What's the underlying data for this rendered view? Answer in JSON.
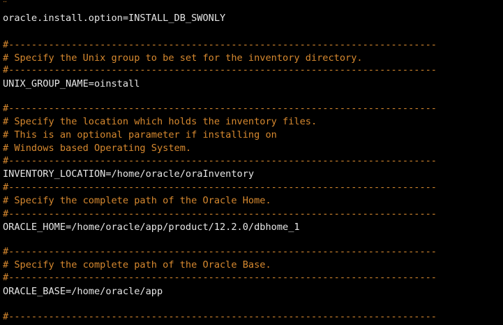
{
  "lines": [
    {
      "text": "#---------------------------------------------------------------------------",
      "type": "comment"
    },
    {
      "text": "oracle.install.option=INSTALL_DB_SWONLY",
      "type": "config"
    },
    {
      "text": "",
      "type": "blank"
    },
    {
      "text": "#---------------------------------------------------------------------------",
      "type": "comment"
    },
    {
      "text": "# Specify the Unix group to be set for the inventory directory.",
      "type": "comment"
    },
    {
      "text": "#---------------------------------------------------------------------------",
      "type": "comment"
    },
    {
      "text": "UNIX_GROUP_NAME=oinstall",
      "type": "config"
    },
    {
      "text": "",
      "type": "blank"
    },
    {
      "text": "#---------------------------------------------------------------------------",
      "type": "comment"
    },
    {
      "text": "# Specify the location which holds the inventory files.",
      "type": "comment"
    },
    {
      "text": "# This is an optional parameter if installing on",
      "type": "comment"
    },
    {
      "text": "# Windows based Operating System.",
      "type": "comment"
    },
    {
      "text": "#---------------------------------------------------------------------------",
      "type": "comment"
    },
    {
      "text": "INVENTORY_LOCATION=/home/oracle/oraInventory",
      "type": "config"
    },
    {
      "text": "#---------------------------------------------------------------------------",
      "type": "comment"
    },
    {
      "text": "# Specify the complete path of the Oracle Home.",
      "type": "comment"
    },
    {
      "text": "#---------------------------------------------------------------------------",
      "type": "comment"
    },
    {
      "text": "ORACLE_HOME=/home/oracle/app/product/12.2.0/dbhome_1",
      "type": "config"
    },
    {
      "text": "",
      "type": "blank"
    },
    {
      "text": "#---------------------------------------------------------------------------",
      "type": "comment"
    },
    {
      "text": "# Specify the complete path of the Oracle Base.",
      "type": "comment"
    },
    {
      "text": "#---------------------------------------------------------------------------",
      "type": "comment"
    },
    {
      "text": "ORACLE_BASE=/home/oracle/app",
      "type": "config"
    },
    {
      "text": "",
      "type": "blank"
    },
    {
      "text": "#---------------------------------------------------------------------------",
      "type": "comment"
    }
  ],
  "colors": {
    "background": "#000000",
    "comment": "#d7892f",
    "config": "#e6e6e6"
  }
}
